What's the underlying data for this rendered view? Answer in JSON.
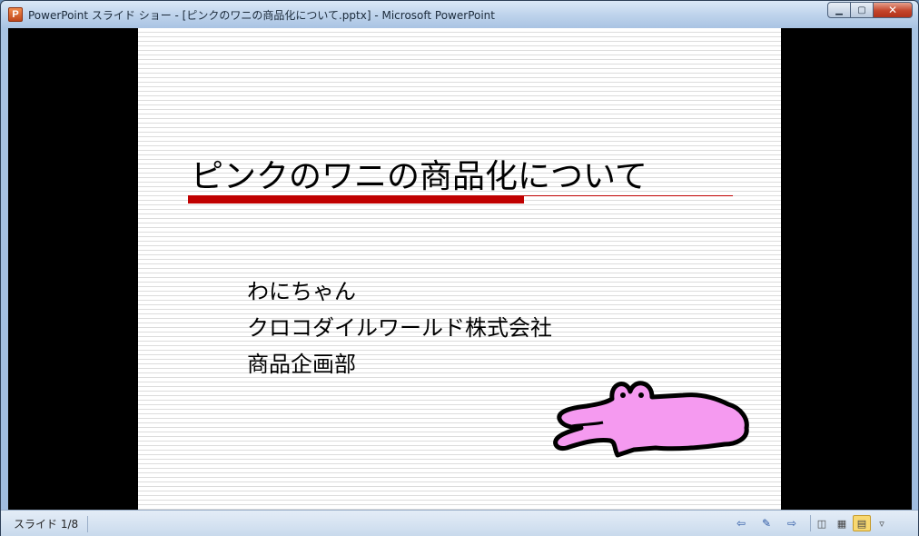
{
  "window": {
    "title": "PowerPoint スライド ショー - [ピンクのワニの商品化について.pptx] - Microsoft PowerPoint",
    "app_icon_letter": "P",
    "controls": {
      "minimize": "▁",
      "maximize": "▢",
      "close": "✕"
    }
  },
  "slide": {
    "title": "ピンクのワニの商品化について",
    "lines": [
      "わにちゃん",
      "クロコダイルワールド株式会社",
      "商品企画部"
    ],
    "accent_color": "#c00000",
    "image_icon": "pink-crocodile-icon"
  },
  "statusbar": {
    "slide_counter": "スライド 1/8",
    "nav": {
      "prev": "⇦",
      "edit": "✎",
      "next": "⇨"
    },
    "views": {
      "normal": "◫",
      "sorter": "▦",
      "reading": "▤",
      "slideshow": "▿"
    }
  },
  "colors": {
    "croc_fill": "#f59af0",
    "croc_outline": "#000000"
  }
}
